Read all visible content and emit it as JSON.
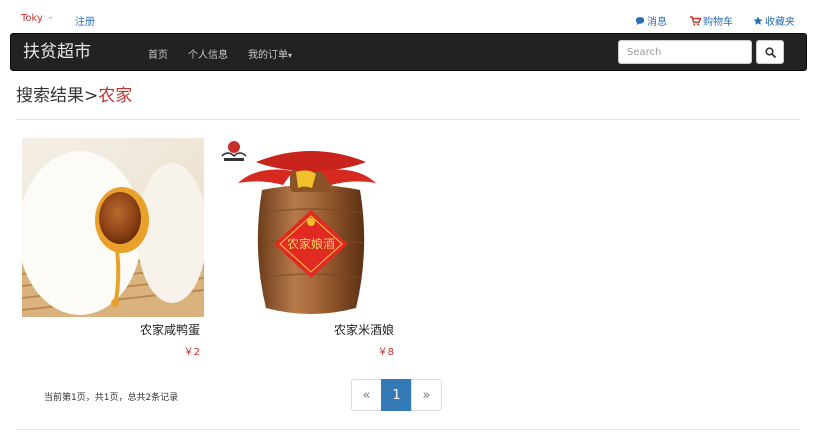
{
  "topbar": {
    "user": "Toky",
    "user_caret": "-",
    "register": "注册",
    "messages": "消息",
    "cart": "购物车",
    "favorites": "收藏夹"
  },
  "navbar": {
    "brand": "扶贫超市",
    "links": [
      "首页",
      "个人信息",
      "我的订单"
    ],
    "search_placeholder": "Search"
  },
  "heading": {
    "prefix": "搜索结果>",
    "keyword": "农家"
  },
  "products": [
    {
      "name": "农家咸鸭蛋",
      "price": "￥2"
    },
    {
      "name": "农家米酒娘",
      "price": "￥8",
      "label": "农家娘酒"
    }
  ],
  "pagination": {
    "info": "当前第1页，共1页，总共2条记录",
    "prev": "«",
    "current": "1",
    "next": "»"
  },
  "colors": {
    "accent": "#c7302a",
    "link": "#337ab7",
    "navbar": "#222222"
  }
}
